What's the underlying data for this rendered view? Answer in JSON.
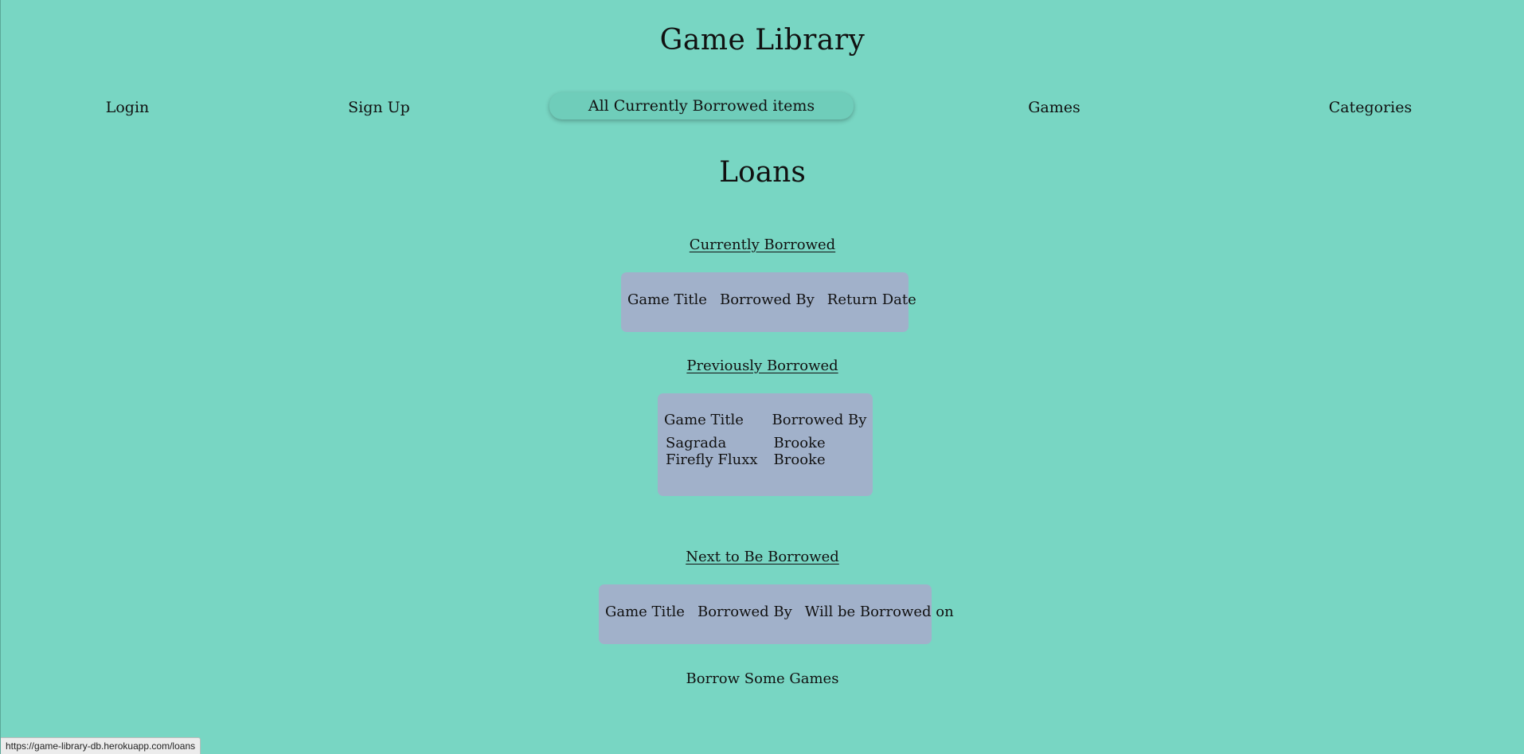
{
  "site_title": "Game Library",
  "nav": {
    "login": "Login",
    "signup": "Sign Up",
    "borrowed": "All Currently Borrowed items",
    "games": "Games",
    "categories": "Categories"
  },
  "page_heading": "Loans",
  "currently_borrowed": {
    "title": "Currently Borrowed",
    "headers": [
      "Game Title",
      "Borrowed By",
      "Return Date"
    ],
    "rows": []
  },
  "previously_borrowed": {
    "title": "Previously Borrowed",
    "headers": [
      "Game Title",
      "Borrowed By"
    ],
    "rows": [
      [
        "Sagrada",
        "Brooke"
      ],
      [
        "Firefly Fluxx",
        "Brooke"
      ]
    ]
  },
  "next_borrowed": {
    "title": "Next to Be Borrowed",
    "headers": [
      "Game Title",
      "Borrowed By",
      "Will be Borrowed on"
    ],
    "rows": []
  },
  "borrow_link": "Borrow Some Games",
  "status_url": "https://game-library-db.herokuapp.com/loans",
  "colors": {
    "background": "#78d6c3",
    "table_box": "#a1b1ca",
    "active_nav": "#6fcdba"
  }
}
